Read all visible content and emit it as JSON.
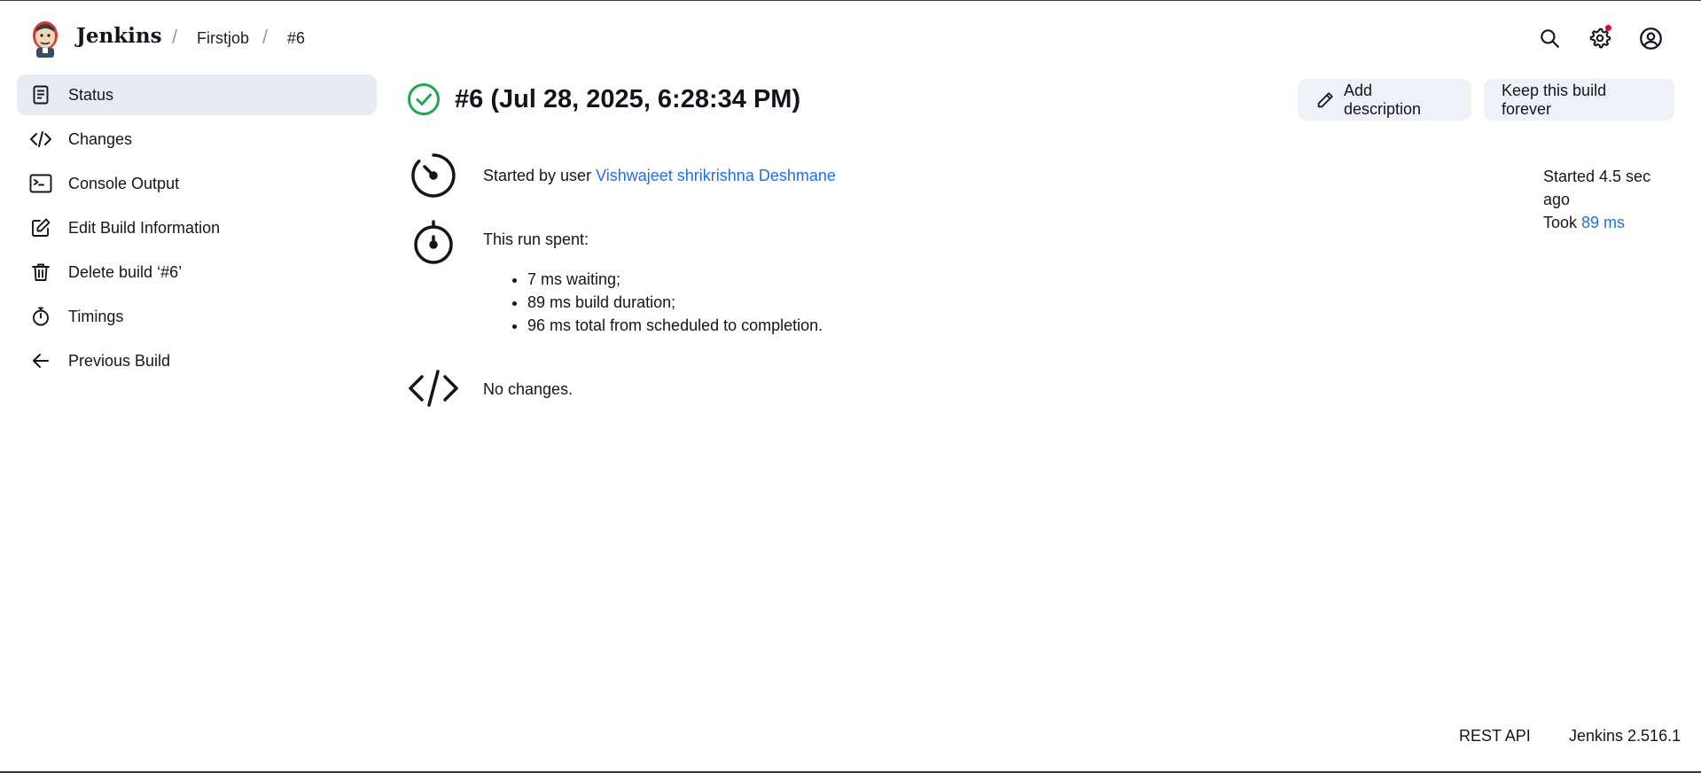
{
  "header": {
    "brand": "Jenkins",
    "breadcrumbs": [
      "Firstjob",
      "#6"
    ],
    "icons": [
      "search-icon",
      "settings-icon",
      "user-icon"
    ]
  },
  "sidebar": {
    "items": [
      {
        "label": "Status",
        "icon": "document-icon",
        "active": true
      },
      {
        "label": "Changes",
        "icon": "code-icon"
      },
      {
        "label": "Console Output",
        "icon": "terminal-icon"
      },
      {
        "label": "Edit Build Information",
        "icon": "edit-icon"
      },
      {
        "label": "Delete build ‘#6’",
        "icon": "trash-icon"
      },
      {
        "label": "Timings",
        "icon": "stopwatch-icon"
      },
      {
        "label": "Previous Build",
        "icon": "arrow-left-icon"
      }
    ]
  },
  "build": {
    "title": "#6 (Jul 28, 2025, 6:28:34 PM)",
    "status": "success",
    "add_description": "Add description",
    "keep_forever": "Keep this build forever",
    "started_by_prefix": "Started by user ",
    "started_by_user": "Vishwajeet shrikrishna Deshmane",
    "run_spent": "This run spent:",
    "spent": [
      "7 ms waiting;",
      "89 ms build duration;",
      "96 ms total from scheduled to completion."
    ],
    "no_changes": "No changes.",
    "started_ago": "Started 4.5 sec ago",
    "took_prefix": "Took ",
    "took_value": "89 ms"
  },
  "footer": {
    "rest_api": "REST API",
    "version": "Jenkins 2.516.1"
  },
  "colors": {
    "accent_link": "#1f6feb",
    "success": "#1fa750",
    "active_bg": "#e8ecf2",
    "notification": "#e6002e"
  }
}
